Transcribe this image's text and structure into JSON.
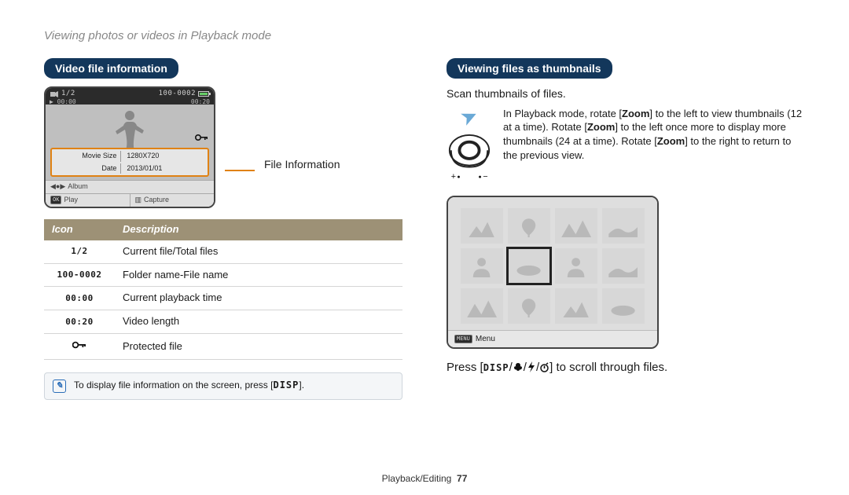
{
  "page_header": "Viewing photos or videos in Playback mode",
  "left": {
    "heading": "Video file information",
    "preview": {
      "counter": "1/2",
      "file_code": "100-0002",
      "elapsed": "00:00",
      "total": "00:20",
      "info_rows": [
        {
          "label": "Movie Size",
          "value": "1280X720"
        },
        {
          "label": "Date",
          "value": "2013/01/01"
        }
      ],
      "album_label": "Album",
      "play_label": "Play",
      "capture_label": "Capture",
      "ok_btn": "OK"
    },
    "callout": "File Information",
    "table_header_icon": "Icon",
    "table_header_desc": "Description",
    "rows": [
      {
        "icon": "1/2",
        "desc": "Current file/Total files"
      },
      {
        "icon": "100-0002",
        "desc": "Folder name-File name"
      },
      {
        "icon": "00:00",
        "desc": "Current playback time"
      },
      {
        "icon": "00:20",
        "desc": "Video length"
      },
      {
        "icon": "⚿",
        "desc": "Protected file"
      }
    ],
    "note_prefix": "To display file information on the screen, press [",
    "note_disp": "DISP",
    "note_suffix": "]."
  },
  "right": {
    "heading": "Viewing files as thumbnails",
    "subtitle": "Scan thumbnails of files.",
    "zoom_text_1": "In Playback mode, rotate [",
    "zoom_text_2": "] to the left to view thumbnails (12 at a time). Rotate [",
    "zoom_text_3": "] to the left once more to display more thumbnails (24 at a time). Rotate [",
    "zoom_text_4": "] to the right to return to the previous view.",
    "zoom_word": "Zoom",
    "menu_btn": "MENU",
    "menu_label": "Menu",
    "press_prefix": "Press [",
    "press_disp": "DISP",
    "press_sep": "/",
    "press_suffix": "] to scroll through files."
  },
  "footer": {
    "section": "Playback/Editing",
    "page": "77"
  }
}
